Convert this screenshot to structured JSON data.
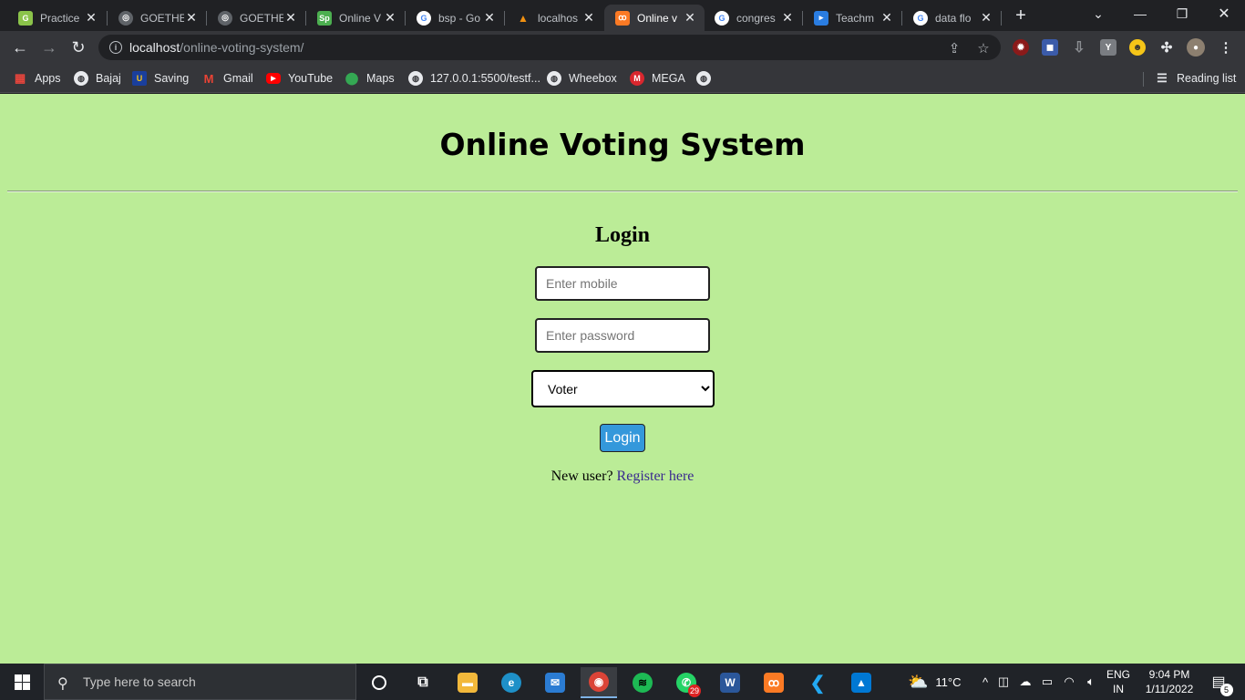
{
  "browser": {
    "tabs": [
      {
        "title": "Practice",
        "icon": "practice-icon",
        "color": "#8bc34a",
        "active": false
      },
      {
        "title": "GOETHE",
        "icon": "globe-icon",
        "color": "#5f6368",
        "active": false
      },
      {
        "title": "GOETHE",
        "icon": "globe-icon",
        "color": "#5f6368",
        "active": false
      },
      {
        "title": "Online V",
        "icon": "sp-icon",
        "color": "#4caf50",
        "active": false
      },
      {
        "title": "bsp - Go",
        "icon": "google-icon",
        "color": "#4285f4",
        "active": false
      },
      {
        "title": "localhos",
        "icon": "phpmyadmin-icon",
        "color": "#f29111",
        "active": false
      },
      {
        "title": "Online v",
        "icon": "xampp-icon",
        "color": "#fb7a24",
        "active": true
      },
      {
        "title": "congres",
        "icon": "google-icon",
        "color": "#4285f4",
        "active": false
      },
      {
        "title": "Teachm",
        "icon": "teachmint-icon",
        "color": "#2a7de1",
        "active": false
      },
      {
        "title": "data flo",
        "icon": "google-icon",
        "color": "#4285f4",
        "active": false
      }
    ],
    "url": {
      "host": "localhost",
      "path": "/online-voting-system/"
    },
    "bookmarks": [
      {
        "label": "Apps",
        "icon": "apps-grid-icon"
      },
      {
        "label": "Bajaj",
        "icon": "globe-icon"
      },
      {
        "label": "Saving",
        "icon": "saving-icon"
      },
      {
        "label": "Gmail",
        "icon": "gmail-icon"
      },
      {
        "label": "YouTube",
        "icon": "youtube-icon"
      },
      {
        "label": "Maps",
        "icon": "maps-icon"
      },
      {
        "label": "127.0.0.1:5500/testf...",
        "icon": "globe-icon"
      },
      {
        "label": "Wheebox",
        "icon": "globe-icon"
      },
      {
        "label": "MEGA",
        "icon": "mega-icon"
      },
      {
        "label": "",
        "icon": "globe-icon"
      }
    ],
    "reading_list": "Reading list"
  },
  "page": {
    "title": "Online Voting System",
    "login_heading": "Login",
    "mobile_placeholder": "Enter mobile",
    "password_placeholder": "Enter password",
    "role_selected": "Voter",
    "login_button": "Login",
    "new_user_text": "New user? ",
    "register_link": "Register here",
    "bg_color": "#bbec97",
    "button_color": "#3498db"
  },
  "taskbar": {
    "search_placeholder": "Type here to search",
    "whatsapp_badge": "29",
    "weather_temp": "11°C",
    "lang_top": "ENG",
    "lang_bottom": "IN",
    "time": "9:04 PM",
    "date": "1/11/2022",
    "notification_count": "5"
  }
}
